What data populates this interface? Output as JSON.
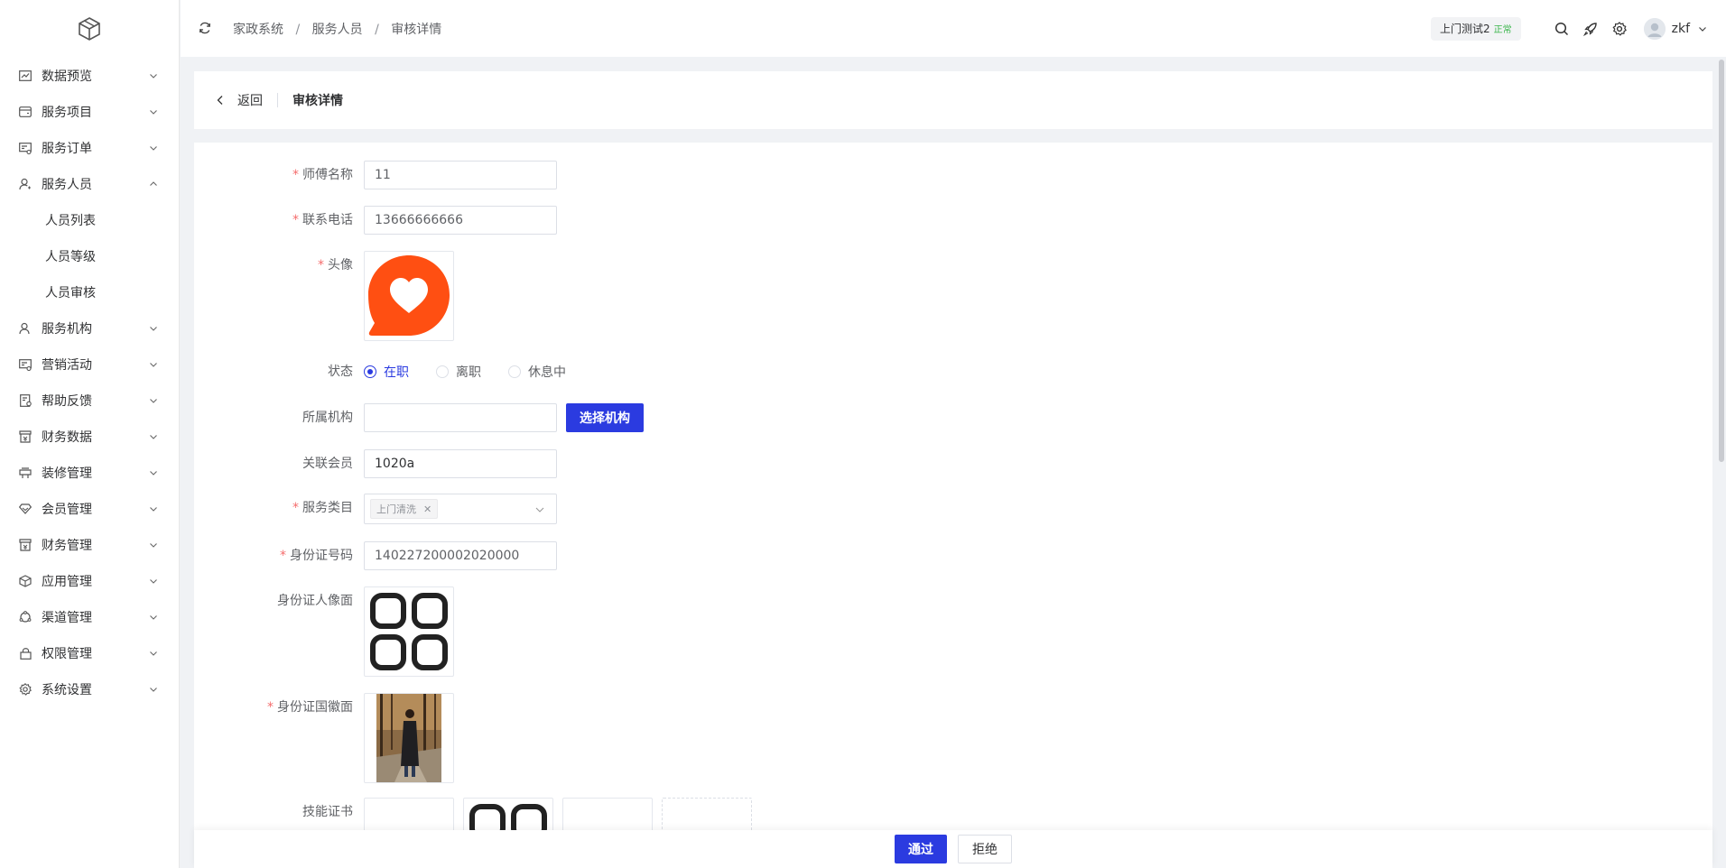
{
  "sidebar": {
    "items": [
      {
        "label": "数据预览",
        "icon": "chart-line-icon",
        "expanded": false
      },
      {
        "label": "服务项目",
        "icon": "wallet-icon",
        "expanded": false
      },
      {
        "label": "服务订单",
        "icon": "order-icon",
        "expanded": false
      },
      {
        "label": "服务人员",
        "icon": "user-icon",
        "expanded": true,
        "children": [
          "人员列表",
          "人员等级",
          "人员审核"
        ]
      },
      {
        "label": "服务机构",
        "icon": "user-group-icon",
        "expanded": false
      },
      {
        "label": "营销活动",
        "icon": "marketing-icon",
        "expanded": false
      },
      {
        "label": "帮助反馈",
        "icon": "feedback-icon",
        "expanded": false
      },
      {
        "label": "财务数据",
        "icon": "finance-icon",
        "expanded": false
      },
      {
        "label": "装修管理",
        "icon": "decor-icon",
        "expanded": false
      },
      {
        "label": "会员管理",
        "icon": "diamond-icon",
        "expanded": false
      },
      {
        "label": "财务管理",
        "icon": "finance-manage-icon",
        "expanded": false
      },
      {
        "label": "应用管理",
        "icon": "cube-icon",
        "expanded": false
      },
      {
        "label": "渠道管理",
        "icon": "channel-icon",
        "expanded": false
      },
      {
        "label": "权限管理",
        "icon": "lock-icon",
        "expanded": false
      },
      {
        "label": "系统设置",
        "icon": "gear-icon",
        "expanded": false
      }
    ]
  },
  "header": {
    "breadcrumb": [
      "家政系统",
      "服务人员",
      "审核详情"
    ],
    "tenant_name": "上门测试2",
    "tenant_status": "正常",
    "username": "zkf"
  },
  "page": {
    "back_label": "返回",
    "title": "审核详情"
  },
  "form": {
    "name_label": "师傅名称",
    "name_value": "11",
    "phone_label": "联系电话",
    "phone_value": "13666666666",
    "avatar_label": "头像",
    "status_label": "状态",
    "status_options": [
      "在职",
      "离职",
      "休息中"
    ],
    "status_selected": "在职",
    "org_label": "所属机构",
    "org_value": "",
    "org_button": "选择机构",
    "member_label": "关联会员",
    "member_value": "1020a",
    "category_label": "服务类目",
    "category_tags": [
      "上门清洗"
    ],
    "idcard_label": "身份证号码",
    "idcard_value": "140227200002020000",
    "id_front_label": "身份证人像面",
    "id_back_label": "身份证国徽面",
    "cert_label": "技能证书"
  },
  "actions": {
    "pass_label": "通过",
    "reject_label": "拒绝"
  },
  "colors": {
    "primary": "#2b3be0",
    "required": "#f56c6c",
    "avatar_brand": "#ff4f12",
    "status_ok": "#39b54a"
  }
}
